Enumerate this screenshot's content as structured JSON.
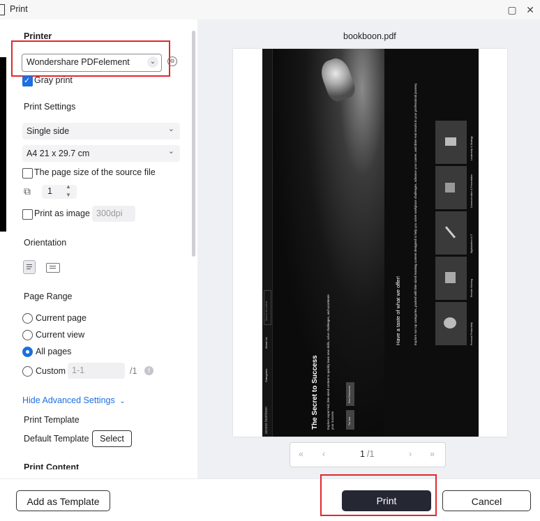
{
  "window": {
    "title": "Print",
    "maximize_icon": "maximize-icon",
    "close_icon": "close-icon"
  },
  "left": {
    "printer_heading": "Printer",
    "printer_value": "Wondershare PDFelement",
    "gray_print": {
      "label": "Gray print",
      "checked": true
    },
    "print_settings_heading": "Print Settings",
    "sides_value": "Single side",
    "paper_value": "A4 21 x 29.7 cm",
    "source_page_size": {
      "label": "The page size of the source file",
      "checked": false
    },
    "copies_value": "1",
    "print_as_image": {
      "label": "Print as image",
      "checked": false
    },
    "dpi_value": "300dpi",
    "orientation_heading": "Orientation",
    "page_range_heading": "Page Range",
    "range_options": [
      {
        "label": "Current page",
        "checked": false
      },
      {
        "label": "Current view",
        "checked": false
      },
      {
        "label": "All pages",
        "checked": true
      },
      {
        "label": "Custom",
        "checked": false
      }
    ],
    "custom_placeholder": "1-1",
    "custom_total": "/1",
    "hide_advanced": "Hide Advanced Settings",
    "print_template_heading": "Print Template",
    "default_template": "Default Template",
    "select_button": "Select",
    "print_content_heading": "Print Content"
  },
  "preview": {
    "filename": "bookboon.pdf",
    "page_indicator": "1",
    "page_total": "/1",
    "doc_texts": {
      "left_title": "The Secret to Success",
      "left_sub": "Explore expert-led, bite-sized content to quickly learn new skills, solve challenges, and accelerate your success",
      "left_btn1": "Try now",
      "left_btn2": "Free Resources",
      "right_title": "Have a taste of what we offer!",
      "right_sub": "Explore our top categories, packed with bite-sized learning content designed to help you solve workplace challenges, advance your career, and drive real results in your professional journey.",
      "cat1": "Leadership & Strategy",
      "cat2": "Communication & Presentation",
      "cat3": "Digitalization & IT",
      "cat4": "Remote Working",
      "cat5": "Personal Productivity",
      "brand": "access bookboon",
      "nav1": "Categories",
      "nav2": "About Us",
      "search": "Search all content"
    }
  },
  "footer": {
    "add_template": "Add as Template",
    "print": "Print",
    "cancel": "Cancel"
  },
  "colors": {
    "accent": "#1d6fe0",
    "highlight_red": "#e0282e",
    "print_button": "#252733"
  }
}
